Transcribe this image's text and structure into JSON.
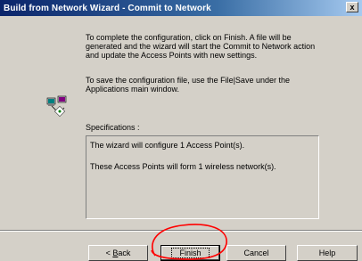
{
  "window": {
    "title": "Build from Network Wizard - Commit to Network",
    "close_label": "x"
  },
  "body": {
    "paragraph1": "To complete the configuration, click on Finish. A file will be generated and the wizard will start the Commit to Network action and update the Access Points with new settings.",
    "paragraph2": "To save the configuration file, use the File|Save under the Applications main window.",
    "specifications_label": "Specifications :",
    "specifications": [
      "The wizard will configure 1 Access Point(s).",
      "These Access Points will form 1 wireless network(s)."
    ]
  },
  "buttons": {
    "back_prefix": "< ",
    "back_mnemonic": "B",
    "back_rest": "ack",
    "finish": "Finish",
    "cancel": "Cancel",
    "help": "Help"
  },
  "icons": {
    "wizard_icon": "network-computer-icon"
  },
  "colors": {
    "dialog_bg": "#d4d0c8",
    "titlebar_start": "#0a246a",
    "titlebar_end": "#a6caf0",
    "annotation_circle": "#ff0000"
  }
}
